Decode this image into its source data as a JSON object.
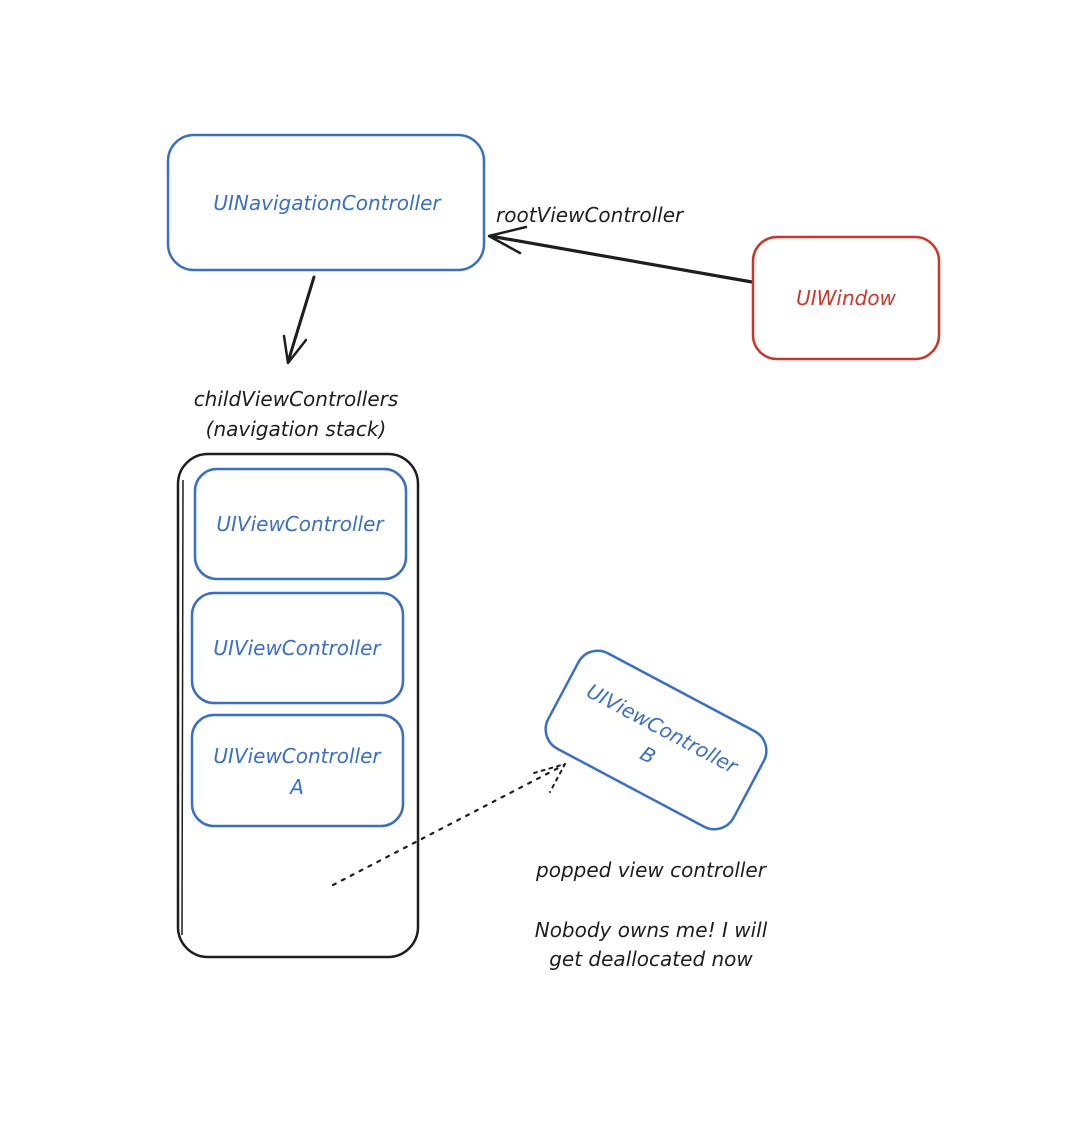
{
  "colors": {
    "blue": "#3a6fc4",
    "red": "#c9372c",
    "black": "#1e1e1e",
    "background": "#ffffff"
  },
  "nodes": {
    "nav_controller": {
      "label": "UINavigationController"
    },
    "window": {
      "label": "UIWindow"
    },
    "stack_vc_1": {
      "label": "UIViewController"
    },
    "stack_vc_2": {
      "label": "UIViewController"
    },
    "stack_vc_3": {
      "label_line1": "UIViewController",
      "label_line2": "A"
    },
    "popped_vc": {
      "label_line1": "UIViewController",
      "label_line2": "B"
    }
  },
  "edges": {
    "root_view_controller": {
      "label": "rootViewController"
    }
  },
  "labels": {
    "child_view_controllers_line1": "childViewControllers",
    "child_view_controllers_line2": "(navigation stack)",
    "popped_caption": "popped view controller",
    "nobody_owns_line1": "Nobody owns me! I will",
    "nobody_owns_line2": "get deallocated now"
  }
}
